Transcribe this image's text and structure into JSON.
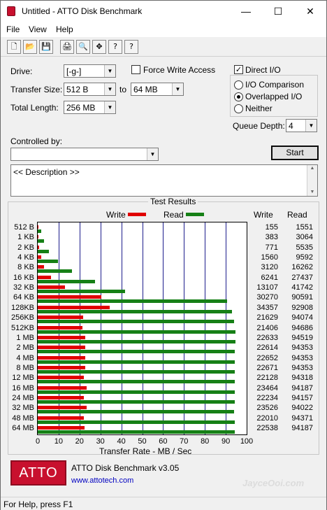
{
  "window": {
    "title": "Untitled - ATTO Disk Benchmark",
    "min": "—",
    "max": "☐",
    "close": "✕"
  },
  "menu": [
    "File",
    "View",
    "Help"
  ],
  "toolbar": {
    "new": "🗋",
    "open": "📂",
    "save": "💾",
    "print": "🖨",
    "preview": "🔍",
    "move": "✥",
    "help": "?",
    "whats_this": "?"
  },
  "settings": {
    "drive_label": "Drive:",
    "drive_value": "[-g-]",
    "transfer_size_label": "Transfer Size:",
    "transfer_from": "512 B",
    "to_label": "to",
    "transfer_to": "64 MB",
    "total_length_label": "Total Length:",
    "total_length": "256 MB",
    "force_write_label": "Force Write Access",
    "force_write_checked": false,
    "direct_io_label": "Direct I/O",
    "direct_io_checked": true,
    "radio_io_comparison": "I/O Comparison",
    "radio_overlapped": "Overlapped I/O",
    "radio_neither": "Neither",
    "selected_radio": "Overlapped I/O",
    "queue_depth_label": "Queue Depth:",
    "queue_depth": "4",
    "controlled_by_label": "Controlled by:",
    "controlled_by": "",
    "start_label": "Start",
    "description": "<< Description >>"
  },
  "results": {
    "group_title": "Test Results",
    "legend_write": "Write",
    "legend_read": "Read",
    "col_write": "Write",
    "col_read": "Read",
    "xlabel": "Transfer Rate - MB / Sec",
    "write_color": "#e00000",
    "read_color": "#168016"
  },
  "chart_data": {
    "type": "bar",
    "orientation": "horizontal",
    "categories": [
      "512 B",
      "1 KB",
      "2 KB",
      "4 KB",
      "8 KB",
      "16 KB",
      "32 KB",
      "64 KB",
      "128KB",
      "256KB",
      "512KB",
      "1 MB",
      "2 MB",
      "4 MB",
      "8 MB",
      "12 MB",
      "16 MB",
      "24 MB",
      "32 MB",
      "48 MB",
      "64 MB"
    ],
    "series": [
      {
        "name": "Write",
        "values": [
          0.2,
          0.4,
          0.8,
          1.6,
          3.1,
          6.2,
          13.1,
          30.3,
          34.4,
          21.6,
          21.4,
          22.6,
          22.6,
          22.7,
          22.7,
          22.1,
          23.5,
          22.2,
          23.5,
          22.0,
          22.5
        ]
      },
      {
        "name": "Read",
        "values": [
          1.6,
          3.1,
          5.5,
          9.6,
          16.3,
          27.4,
          41.7,
          90.6,
          92.9,
          94.1,
          94.7,
          94.5,
          94.4,
          94.4,
          94.4,
          94.3,
          94.2,
          94.2,
          94.0,
          94.4,
          94.2
        ]
      }
    ],
    "x_ticks": [
      "0",
      "10",
      "20",
      "30",
      "40",
      "50",
      "60",
      "70",
      "80",
      "90",
      "100"
    ],
    "xlim": [
      0,
      100
    ],
    "xlabel": "Transfer Rate - MB / Sec",
    "legend": "top-center",
    "grid": true
  },
  "table": {
    "write": [
      "155",
      "383",
      "771",
      "1560",
      "3120",
      "6241",
      "13107",
      "30270",
      "34357",
      "21629",
      "21406",
      "22633",
      "22614",
      "22652",
      "22671",
      "22128",
      "23464",
      "22234",
      "23526",
      "22010",
      "22538"
    ],
    "read": [
      "1551",
      "3064",
      "5535",
      "9592",
      "16262",
      "27437",
      "41742",
      "90591",
      "92908",
      "94074",
      "94686",
      "94519",
      "94353",
      "94353",
      "94353",
      "94318",
      "94187",
      "94157",
      "94022",
      "94371",
      "94187"
    ]
  },
  "footer": {
    "logo": "ATTO",
    "product": "ATTO Disk Benchmark v3.05",
    "link": "www.attotech.com",
    "watermark": "JayceOoi.com"
  },
  "status": "For Help, press F1"
}
